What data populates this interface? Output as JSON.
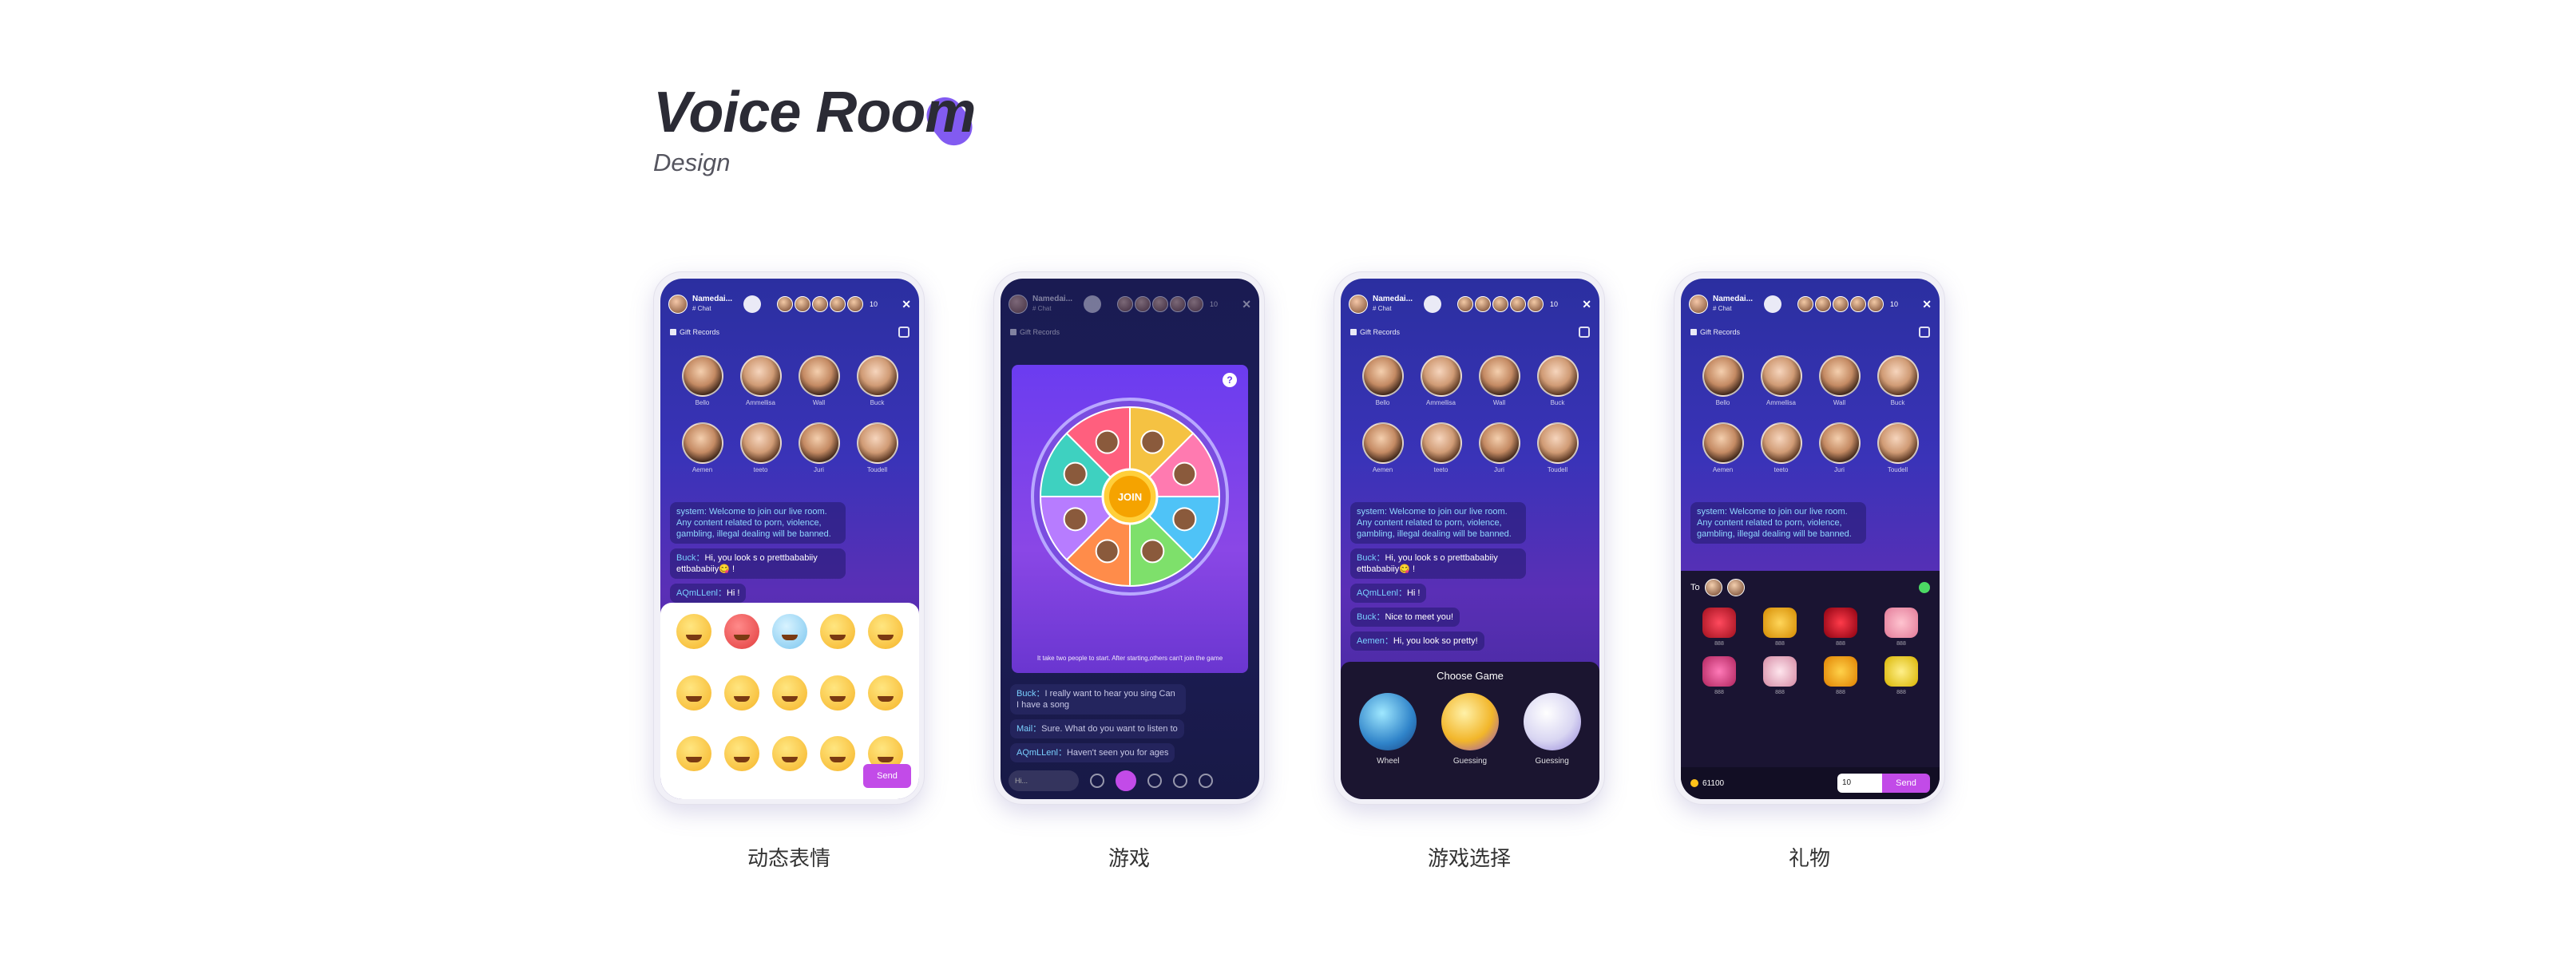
{
  "header": {
    "title": "Voice Room",
    "subtitle": "Design"
  },
  "colors": {
    "accent": "#7b52f0",
    "send": "#c24be8"
  },
  "room": {
    "name": "Namedai...",
    "tag": "# Chat",
    "viewer_count": "10",
    "gift_records": "Gift Records",
    "seats": [
      "Bello",
      "Ammellisa",
      "Wall",
      "Buck",
      "Aemen",
      "teeto",
      "Juri",
      "Toudell"
    ]
  },
  "chat": {
    "system": "system: Welcome to join our live room. Any content related to porn, violence, gambling, illegal dealing will be banned.",
    "m1_who": "Buck：",
    "m1_text": "Hi, you look s o prettbababiiy ettbababiiy😋 !",
    "m2_who": "AQmLLenl：",
    "m2_text": "Hi !",
    "m3_who": "Buck：",
    "m3_text": "Nice to meet you!",
    "m4_who": "Aemen：",
    "m4_text": "Hi, you look so pretty!",
    "g1_who": "Buck：",
    "g1_text": "I really want to hear you sing Can I have a song",
    "g2_who": "Mail：",
    "g2_text": "Sure. What do you want to listen to",
    "g3_who": "AQmLLenl：",
    "g3_text": "Haven't seen you for ages"
  },
  "emoji_panel": {
    "send": "Send"
  },
  "wheel": {
    "center": "JOIN",
    "help": "?",
    "note": "It take two people to start. After starting,others can't join the game"
  },
  "game_select": {
    "title": "Choose Game",
    "games": [
      "Wheel",
      "Guessing",
      "Guessing"
    ]
  },
  "gift": {
    "to": "To",
    "price": "888",
    "balance": "61100",
    "quantity": "10",
    "send": "Send"
  },
  "captions": [
    "动态表情",
    "游戏",
    "游戏选择",
    "礼物"
  ]
}
